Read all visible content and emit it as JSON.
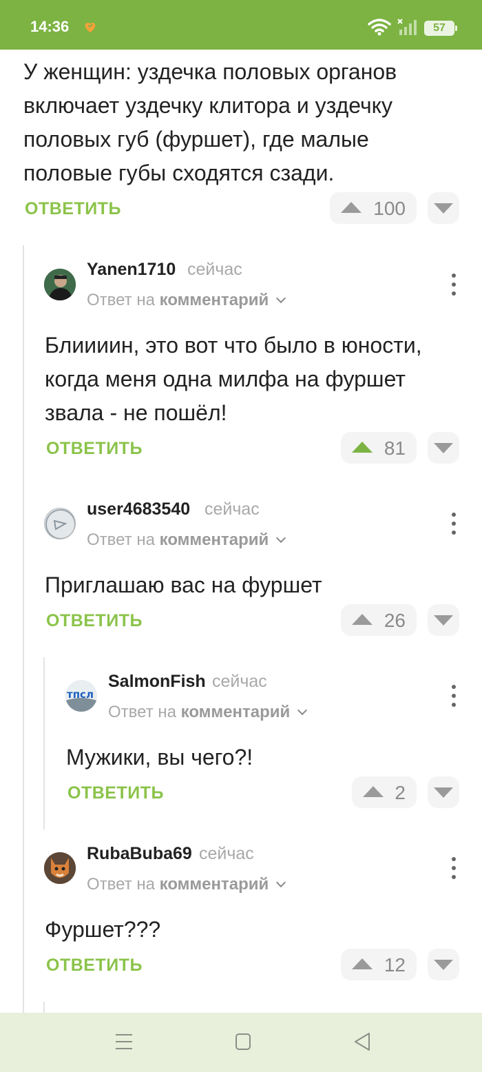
{
  "status_bar": {
    "time": "14:36",
    "battery": "57"
  },
  "parent_comment": {
    "text_lines": [
      "У женщин: уздечка половых органов",
      "включает уздечку клитора и уздечку",
      "половых губ (фуршет), где малые",
      "половые губы сходятся сзади."
    ],
    "reply_label": "ОТВЕТИТЬ",
    "rating": "100"
  },
  "comments": [
    {
      "username": "Yanen1710",
      "time": "сейчас",
      "reply_prefix": "Ответ на",
      "reply_target": "комментарий",
      "text_lines": [
        "Блиииин, это вот что было в юности,",
        "когда меня одна милфа на фуршет",
        "звала - не пошёл!"
      ],
      "reply_label": "ОТВЕТИТЬ",
      "rating": "81",
      "upvoted": true
    },
    {
      "username": "user4683540",
      "time": "сейчас",
      "reply_prefix": "Ответ на",
      "reply_target": "комментарий",
      "text_lines": [
        "Приглашаю вас на фуршет"
      ],
      "reply_label": "ОТВЕТИТЬ",
      "rating": "26",
      "upvoted": false
    },
    {
      "username": "SalmonFish",
      "time": "сейчас",
      "reply_prefix": "Ответ на",
      "reply_target": "комментарий",
      "avatar_text": "тпсл",
      "text_lines": [
        "Мужики, вы чего?!"
      ],
      "reply_label": "ОТВЕТИТЬ",
      "rating": "2",
      "upvoted": false
    },
    {
      "username": "RubaBuba69",
      "time": "сейчас",
      "reply_prefix": "Ответ на",
      "reply_target": "комментарий",
      "text_lines": [
        "Фуршет???"
      ],
      "reply_label": "ОТВЕТИТЬ",
      "rating": "12",
      "upvoted": false
    }
  ],
  "colors": {
    "brand_green": "#7cb342",
    "reply_green": "#8bc34a",
    "nav_bg": "#e8f0dc"
  },
  "icons": [
    "heart-icon",
    "wifi-icon",
    "signal-icon",
    "battery-icon",
    "upvote-icon",
    "downvote-icon",
    "more-vertical-icon",
    "chevron-down-icon",
    "menu-icon",
    "home-square-icon",
    "back-triangle-icon"
  ]
}
